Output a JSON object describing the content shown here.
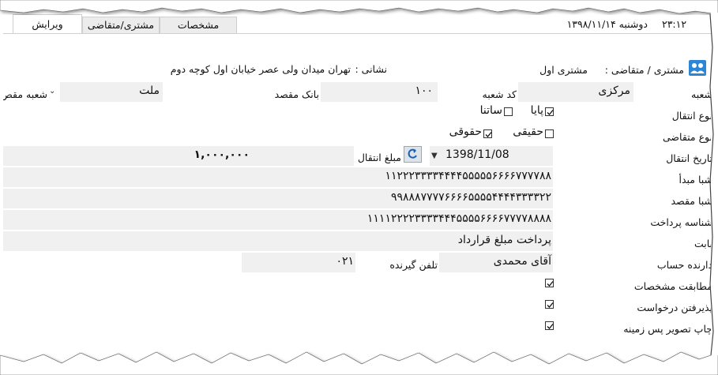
{
  "tabs": [
    {
      "label": "ویرایش",
      "active": true
    },
    {
      "label": "مشتری/متقاضی",
      "active": false
    },
    {
      "label": "مشخصات",
      "active": false
    }
  ],
  "header": {
    "date": "دوشنبه ۱۳۹۸/۱۱/۱۴",
    "time": "۲۳:۱۲"
  },
  "customer": {
    "prefix": "مشتری / متقاضی :",
    "name": "مشتری اول",
    "address_label": "نشانی :",
    "address": "تهران میدان ولی عصر خیابان اول کوچه دوم"
  },
  "form": {
    "branch": {
      "label": "شعبه",
      "value": "مرکزی"
    },
    "branch_code": {
      "label": "کد شعبه",
      "value": "۱۰۰"
    },
    "dest_bank": {
      "label": "بانک مقصد",
      "value": "ملت"
    },
    "dest_branch": {
      "label": "شعبه مقص",
      "selected": ""
    },
    "transfer_type": {
      "label": "نوع انتقال",
      "options": [
        {
          "label": "پایا",
          "checked": true
        },
        {
          "label": "ساتنا",
          "checked": false
        }
      ]
    },
    "applicant_type": {
      "label": "نوع متقاضی",
      "options": [
        {
          "label": "حقیقی",
          "checked": false
        },
        {
          "label": "حقوقی",
          "checked": true
        }
      ]
    },
    "transfer_date": {
      "label": "تاریخ انتقال",
      "value": "1398/11/08"
    },
    "amount": {
      "label": "مبلغ انتقال",
      "value": "۱,۰۰۰,۰۰۰"
    },
    "source_sheba": {
      "label": "شبا مبدأ",
      "value": "۱۱۲۲۲۳۳۳۳۴۴۴۴۵۵۵۵۵۶۶۶۶۷۷۷۷۸۸"
    },
    "dest_sheba": {
      "label": "شبا مقصد",
      "value": "۹۹۸۸۸۷۷۷۷۶۶۶۶۵۵۵۵۴۴۴۴۳۳۳۳۲۲"
    },
    "payment_id": {
      "label": "شناسه پرداخت",
      "value": "۱۱۱۱۲۲۲۲۳۳۳۳۴۴۴۵۵۵۵۶۶۶۶۷۷۷۷۸۸۸۸"
    },
    "reason": {
      "label": "بابت",
      "value": "پرداخت مبلغ قرارداد"
    },
    "account_holder": {
      "label": "دارنده حساب",
      "value": "آقای محمدی"
    },
    "receiver_phone": {
      "label": "تلفن گیرنده",
      "value": "۰۲۱"
    },
    "match_details": {
      "label": "مطابقت مشخصات",
      "checked": true
    },
    "accept_request": {
      "label": "پذیرفتن درخواست",
      "checked": true
    },
    "print_background": {
      "label": "چاپ تصویر پس زمینه",
      "checked": true
    }
  },
  "colors": {
    "accent": "#2c86d8",
    "field_bg": "#f0f0f0",
    "tab_bg": "#ececec"
  }
}
